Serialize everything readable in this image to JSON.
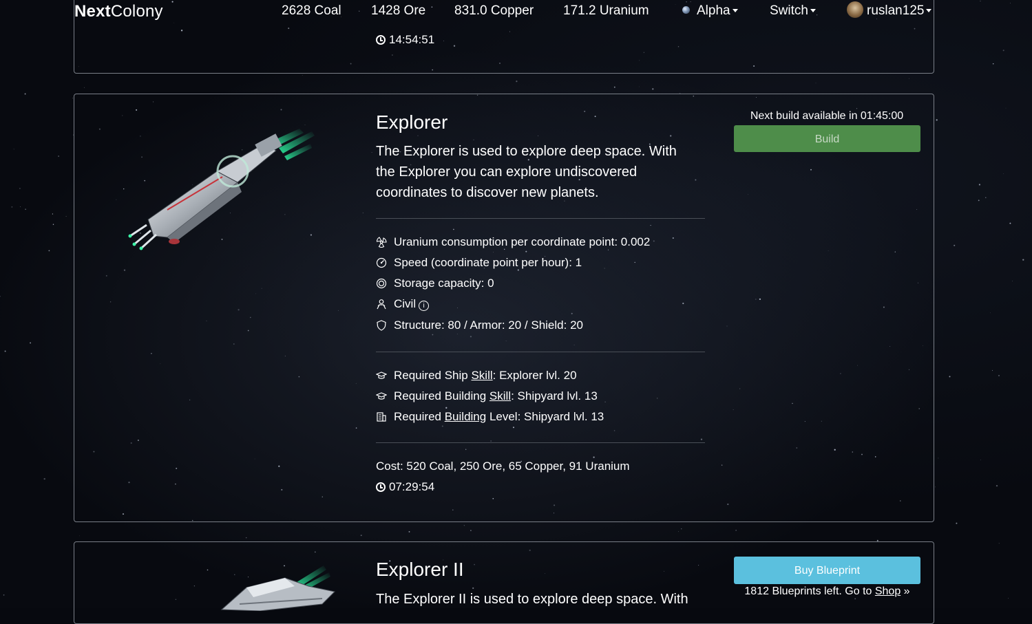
{
  "navbar": {
    "brand_bold": "Next",
    "brand_rest": "Colony",
    "coal": "2628 Coal",
    "ore": "1428 Ore",
    "copper": "831.0 Copper",
    "uranium": "171.2 Uranium",
    "planet": "Alpha",
    "switch": "Switch",
    "user": "ruslan125"
  },
  "top_card": {
    "timer": "14:54:51"
  },
  "explorer": {
    "title": "Explorer",
    "description": "The Explorer is used to explore deep space. With the Explorer you can explore undiscovered coordinates to discover new planets.",
    "stats": {
      "uranium": "Uranium consumption per coordinate point: 0.002",
      "speed": "Speed (coordinate point per hour): 1",
      "storage": "Storage capacity: 0",
      "class": "Civil",
      "class_info": "i",
      "defense": "Structure: 80 / Armor: 20 / Shield: 20"
    },
    "requirements": {
      "ship_prefix": "Required Ship ",
      "ship_link": "Skill",
      "ship_suffix": ": Explorer lvl. 20",
      "building_skill_prefix": "Required Building ",
      "building_skill_link": "Skill",
      "building_skill_suffix": ": Shipyard lvl. 13",
      "building_level_prefix": "Required ",
      "building_level_link": "Building",
      "building_level_suffix": " Level: Shipyard lvl. 13"
    },
    "cost": "Cost: 520 Coal, 250 Ore, 65 Copper, 91 Uranium",
    "build_time": "07:29:54",
    "next_build": "Next build available in 01:45:00",
    "build_label": "Build"
  },
  "explorer2": {
    "title": "Explorer II",
    "description_start": "The Explorer II is used to explore deep space. With",
    "buy_label": "Buy Blueprint",
    "blueprints_prefix": "1812 Blueprints left. Go to ",
    "shop_link": "Shop",
    "blueprints_suffix": " »"
  }
}
